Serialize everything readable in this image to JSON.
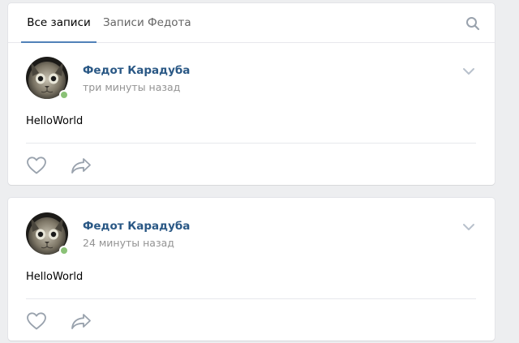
{
  "tabs": {
    "all_posts": "Все записи",
    "author_posts": "Записи Федота"
  },
  "icons": {
    "search": "search-icon",
    "chevron": "chevron-down-icon",
    "like": "heart-icon",
    "share": "share-arrow-icon"
  },
  "colors": {
    "background": "#edeef0",
    "link": "#2a5885",
    "tab_underline": "#5181b8",
    "online": "#8ac176",
    "icon": "#99a2ad"
  },
  "posts": [
    {
      "author": "Федот Карадуба",
      "time": "три минуты назад",
      "text": "HelloWorld",
      "online": true
    },
    {
      "author": "Федот Карадуба",
      "time": "24 минуты назад",
      "text": "HelloWorld",
      "online": true
    }
  ]
}
